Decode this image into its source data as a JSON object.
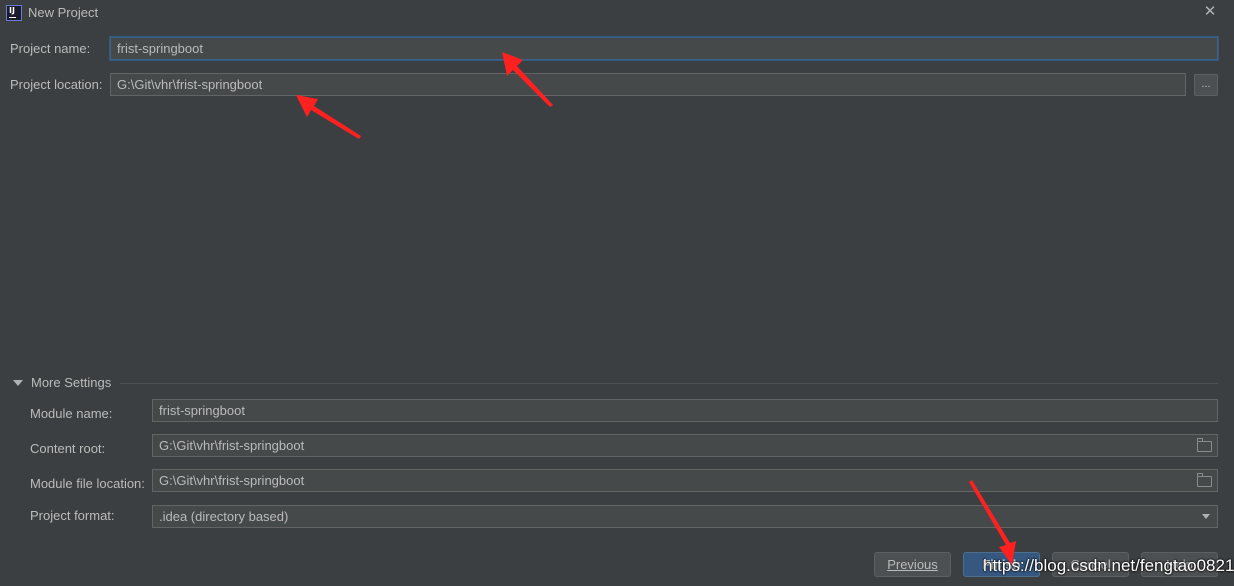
{
  "window": {
    "title": "New Project",
    "icon": "intellij-idea-icon",
    "close_glyph": "✕"
  },
  "project": {
    "name_label": "Project name:",
    "name_value": "frist-springboot",
    "location_label": "Project location:",
    "location_value": "G:\\Git\\vhr\\frist-springboot",
    "browse_label": "..."
  },
  "more_settings": {
    "header": "More Settings",
    "module_name_label": "Module name:",
    "module_name_value": "frist-springboot",
    "content_root_label": "Content root:",
    "content_root_value": "G:\\Git\\vhr\\frist-springboot",
    "module_file_location_label": "Module file location:",
    "module_file_location_value": "G:\\Git\\vhr\\frist-springboot",
    "project_format_label": "Project format:",
    "project_format_value": ".idea (directory based)"
  },
  "buttons": {
    "previous": "Previous",
    "finish": "Finish",
    "cancel": "Cancel",
    "help": "Help"
  },
  "watermark": "https://blog.csdn.net/fengtao0821",
  "colors": {
    "background": "#3c3f41",
    "field": "#45494a",
    "accent": "#365880",
    "annotation_arrow": "#ff2020"
  }
}
